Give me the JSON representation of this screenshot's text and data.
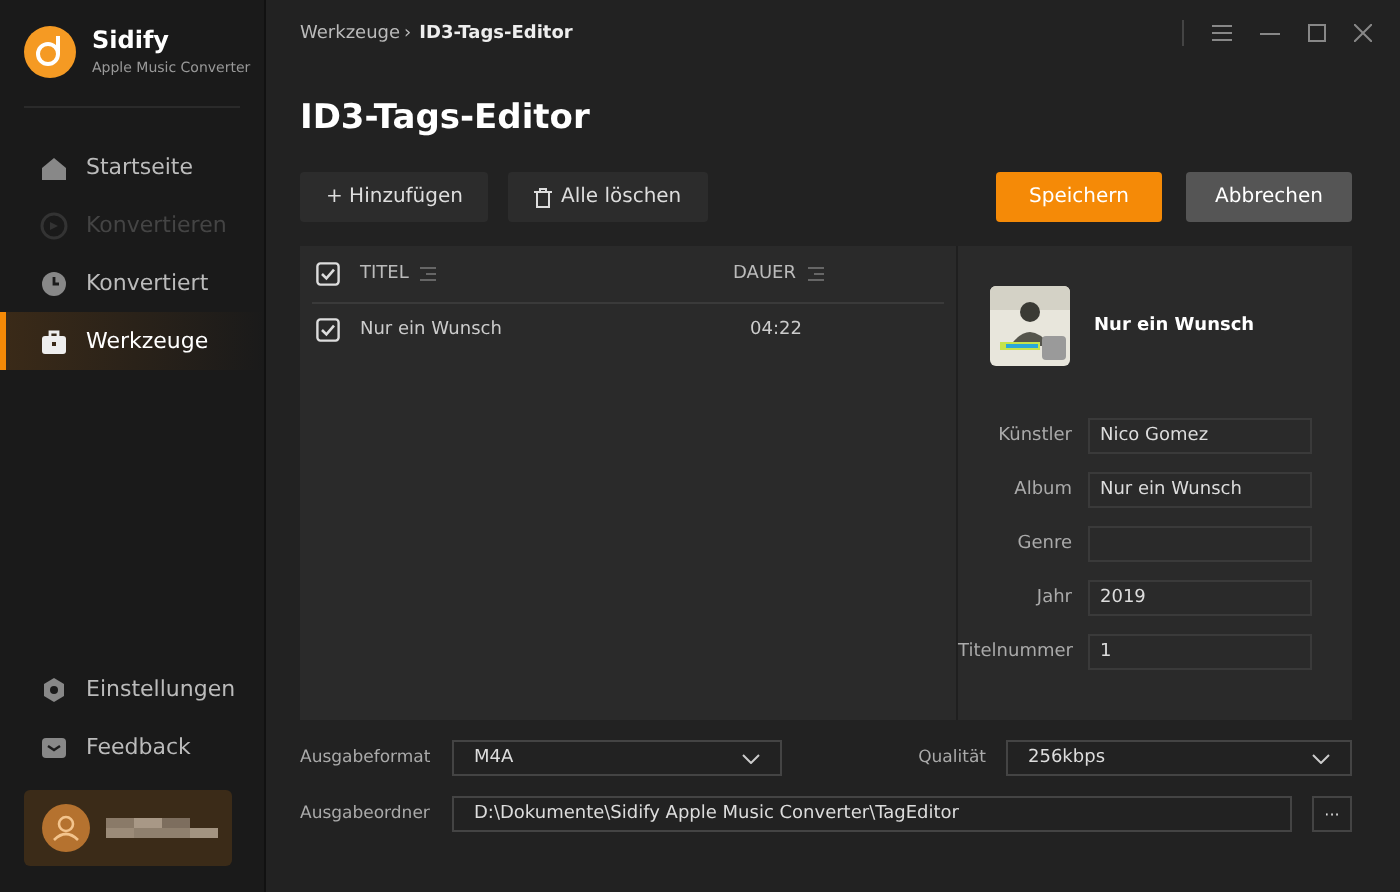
{
  "app": {
    "name": "Sidify",
    "subtitle": "Apple Music Converter"
  },
  "sidebar": {
    "items": [
      {
        "label": "Startseite",
        "selected": false,
        "disabled": false
      },
      {
        "label": "Konvertieren",
        "selected": false,
        "disabled": true
      },
      {
        "label": "Konvertiert",
        "selected": false,
        "disabled": false
      },
      {
        "label": "Werkzeuge",
        "selected": true,
        "disabled": false
      }
    ],
    "bottom_items": [
      {
        "label": "Einstellungen"
      },
      {
        "label": "Feedback"
      }
    ]
  },
  "breadcrumb": [
    "Werkzeuge",
    "ID3-Tags-Editor"
  ],
  "breadcrumb_separator": "›",
  "title": "ID3-Tags-Editor",
  "toolbar": {
    "add": "+ Hinzufügen",
    "clear": "Alle löschen",
    "save": "Speichern",
    "cancel": "Abbrechen"
  },
  "table": {
    "all_checked": true,
    "columns": [
      "TITEL",
      "DAUER"
    ],
    "rows": [
      {
        "title": "Nur ein Wunsch",
        "duration": "04:22",
        "checked": true
      }
    ]
  },
  "details": {
    "track_title": "Nur ein Wunsch",
    "fields": [
      {
        "label": "Künstler",
        "value": "Nico Gomez"
      },
      {
        "label": "Album",
        "value": "Nur ein Wunsch"
      },
      {
        "label": "Genre"
      },
      {
        "label": "Jahr",
        "value": "2019"
      },
      {
        "label": "Titelnummer",
        "value": "1"
      }
    ]
  },
  "output": {
    "format_label": "Ausgabeformat",
    "format": "M4A",
    "quality_label": "Qualität",
    "quality": "256kbps",
    "folder_label": "Ausgabeordner",
    "folder": "D:\\Dokumente\\Sidify Apple Music Converter\\TagEditor",
    "browse": "···"
  }
}
